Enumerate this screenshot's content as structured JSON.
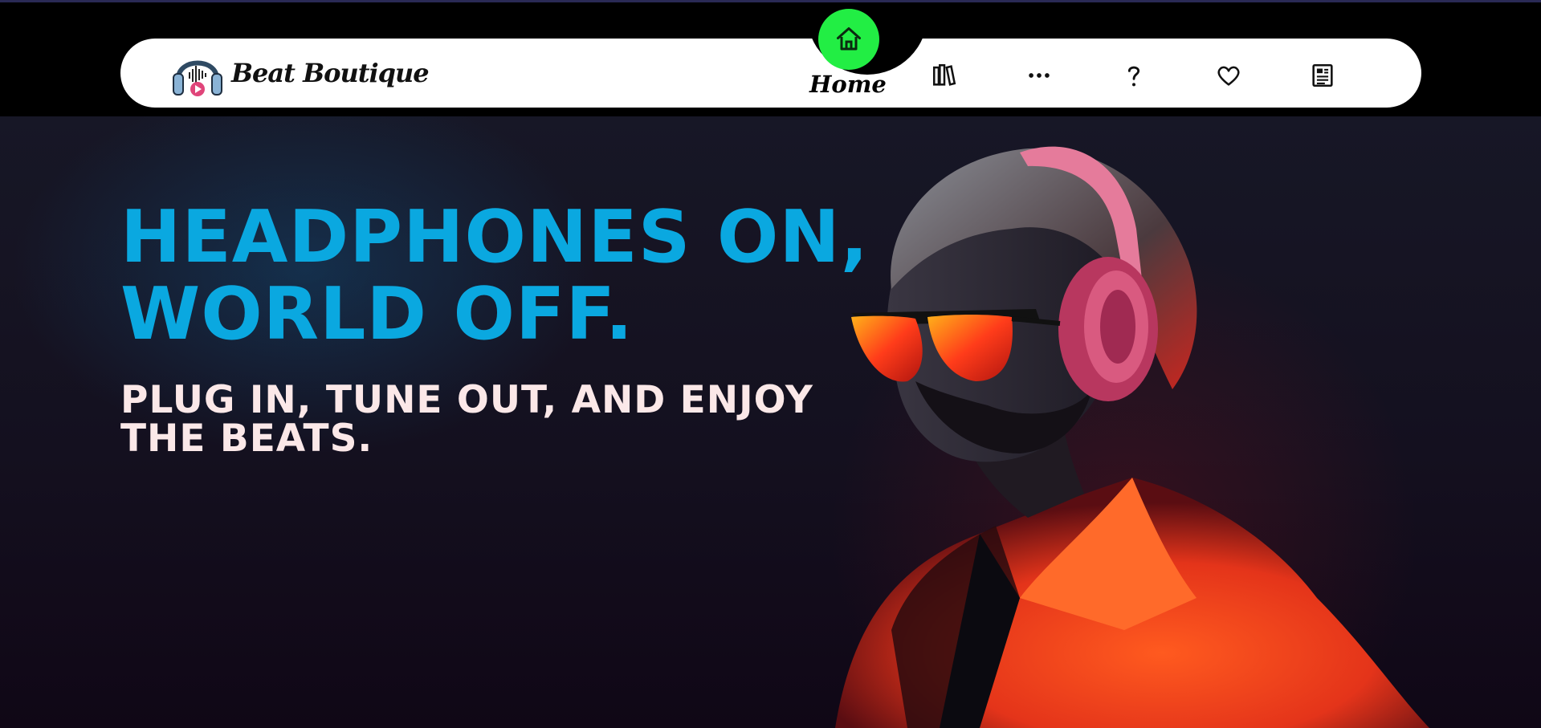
{
  "brand": {
    "name": "Beat Boutique",
    "icon": "headphones-logo-icon"
  },
  "nav": {
    "active": "home",
    "home_label": "Home",
    "items": [
      {
        "icon": "home-icon",
        "label": "Home"
      },
      {
        "icon": "library-icon"
      },
      {
        "icon": "more-dots-icon"
      },
      {
        "icon": "help-question-icon"
      },
      {
        "icon": "heart-icon"
      },
      {
        "icon": "news-icon"
      }
    ]
  },
  "hero": {
    "headline": "HEADPHONES ON, WORLD OFF.",
    "subline": "PLUG IN, TUNE OUT, AND ENJOY THE BEATS.",
    "image": "man-with-headphones-and-sunglasses"
  },
  "colors": {
    "accent_green": "#22ee44",
    "headline_blue": "#0aa8e0",
    "subline_pink": "#fbe8e8",
    "jacket_orange": "#ff4d1a",
    "headphone_pink": "#d94a7a"
  }
}
